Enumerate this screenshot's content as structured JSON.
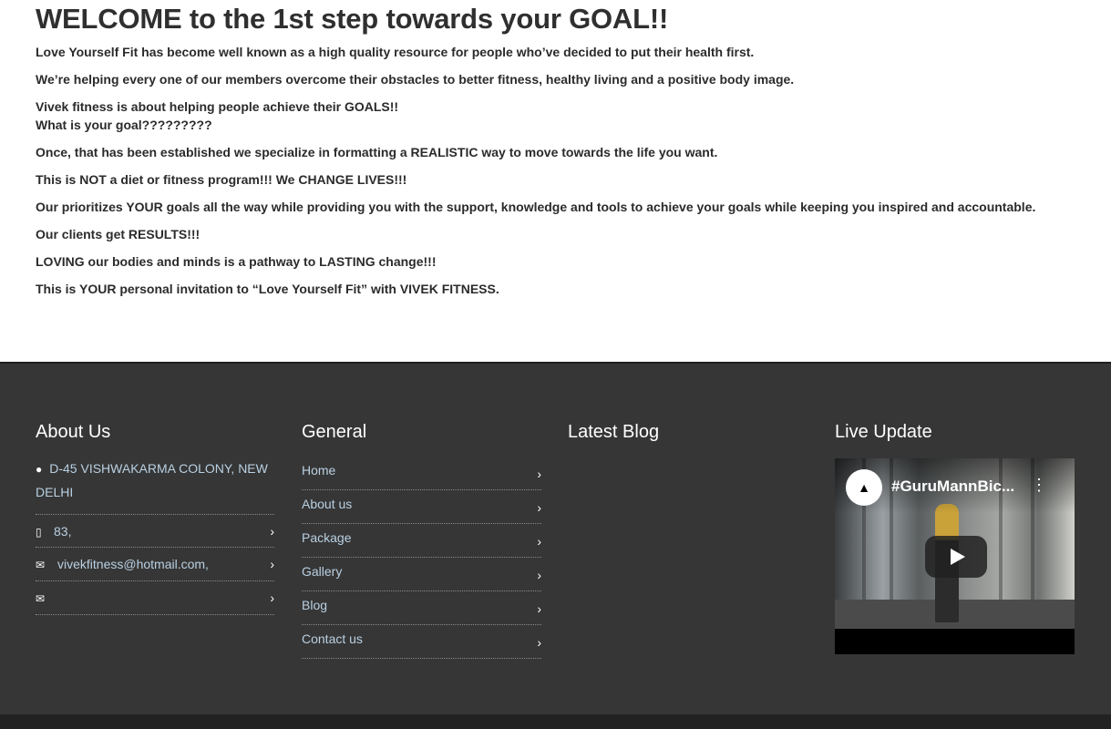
{
  "intro": {
    "heading": "WELCOME to the 1st step towards your GOAL!!",
    "paragraphs": [
      "Love Yourself Fit has become well known as a high quality resource for people who’ve decided to put their health first.",
      "We’re helping every one of our members overcome their obstacles to better fitness, healthy living and a positive body image.",
      "Vivek fitness is about helping people achieve their GOALS!!",
      "What is your goal?????????",
      "Once, that has been established we specialize in formatting a REALISTIC way to move towards the life you want.",
      "This is NOT a diet or fitness program!!! We CHANGE LIVES!!!",
      "Our prioritizes YOUR goals all the way while providing you with the support, knowledge and tools to achieve your goals while keeping you inspired and accountable.",
      "Our clients get RESULTS!!!",
      "LOVING our bodies and minds is a pathway to LASTING change!!!",
      "This is YOUR personal invitation to “Love Yourself Fit” with VIVEK FITNESS."
    ]
  },
  "footer": {
    "about": {
      "title": "About Us",
      "address": "D-45 VISHWAKARMA COLONY, NEW DELHI",
      "rows": [
        {
          "icon": "mobile-icon",
          "text": "83,"
        },
        {
          "icon": "envelope-icon",
          "text": "vivekfitness@hotmail.com,"
        },
        {
          "icon": "envelope-icon",
          "text": ""
        }
      ]
    },
    "general": {
      "title": "General",
      "items": [
        "Home",
        "About us",
        "Package",
        "Gallery",
        "Blog",
        "Contact us"
      ]
    },
    "blog": {
      "title": "Latest Blog"
    },
    "live": {
      "title": "Live Update",
      "video_title": "#GuruMannBic..."
    }
  },
  "colors": {
    "footer_bg": "#363636",
    "footer_text": "#b9d0e2",
    "footer_heading": "#ffffff"
  }
}
